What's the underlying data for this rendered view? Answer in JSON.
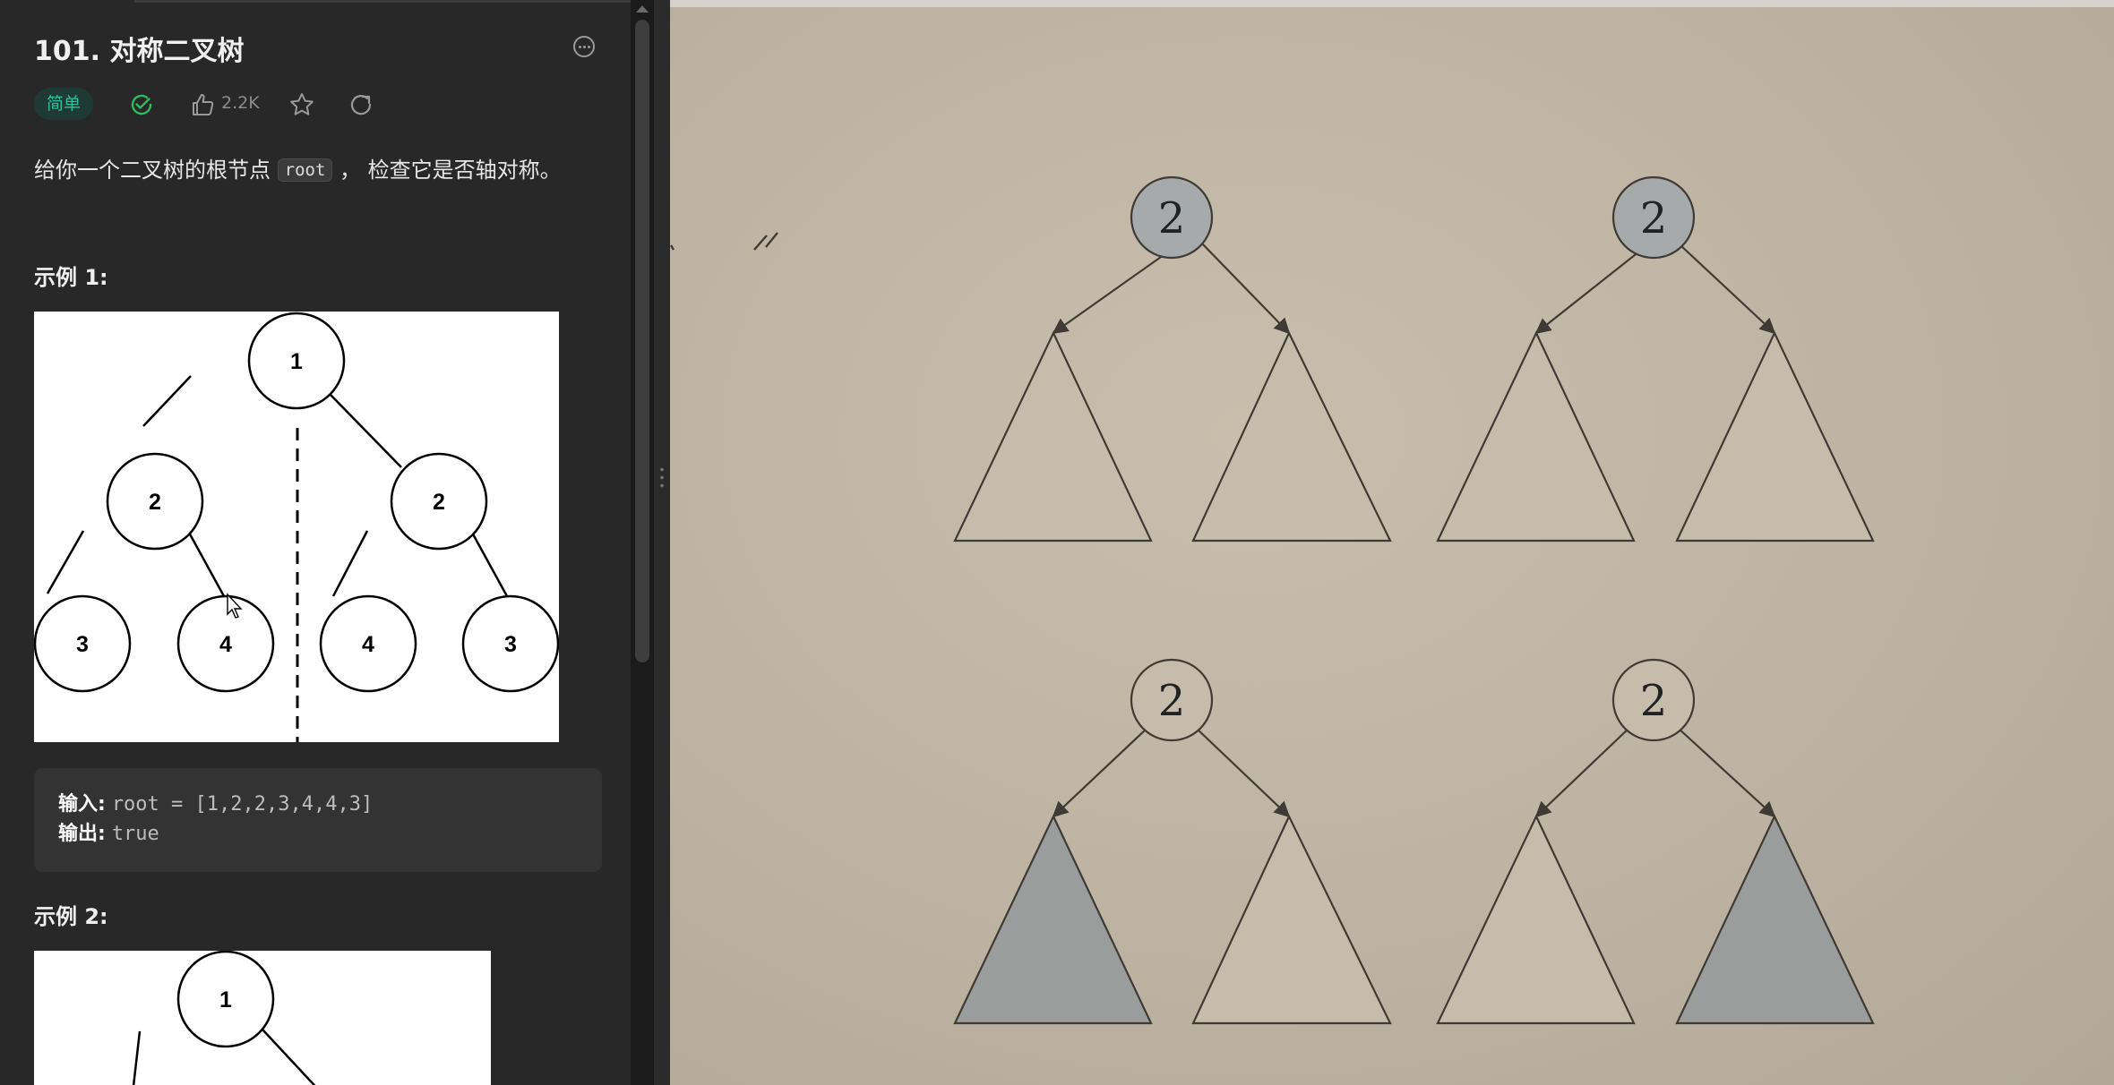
{
  "problem": {
    "title": "101. 对称二叉树",
    "difficulty": "简单",
    "likes": "2.2K",
    "desc_before": "给你一个二叉树的根节点",
    "desc_code": "root",
    "desc_after": "， 检查它是否轴对称。"
  },
  "example1": {
    "title": "示例 1:",
    "tree_values": [
      "1",
      "2",
      "2",
      "3",
      "4",
      "4",
      "3"
    ],
    "input_label": "输入:",
    "input_value": "root = [1,2,2,3,4,4,3]",
    "output_label": "输出:",
    "output_value": "true"
  },
  "example2": {
    "title": "示例 2:",
    "root_value": "1"
  },
  "diagram": {
    "node_label": "2",
    "colors": {
      "highlight": "#a7aaab",
      "plain": "#c6bcab",
      "shaded_triangle": "#9a9d9c",
      "stroke": "#3f3a33"
    }
  },
  "icons": [
    "more-icon",
    "solved-check-icon",
    "thumbs-up-icon",
    "star-icon",
    "share-icon",
    "cursor-icon"
  ]
}
